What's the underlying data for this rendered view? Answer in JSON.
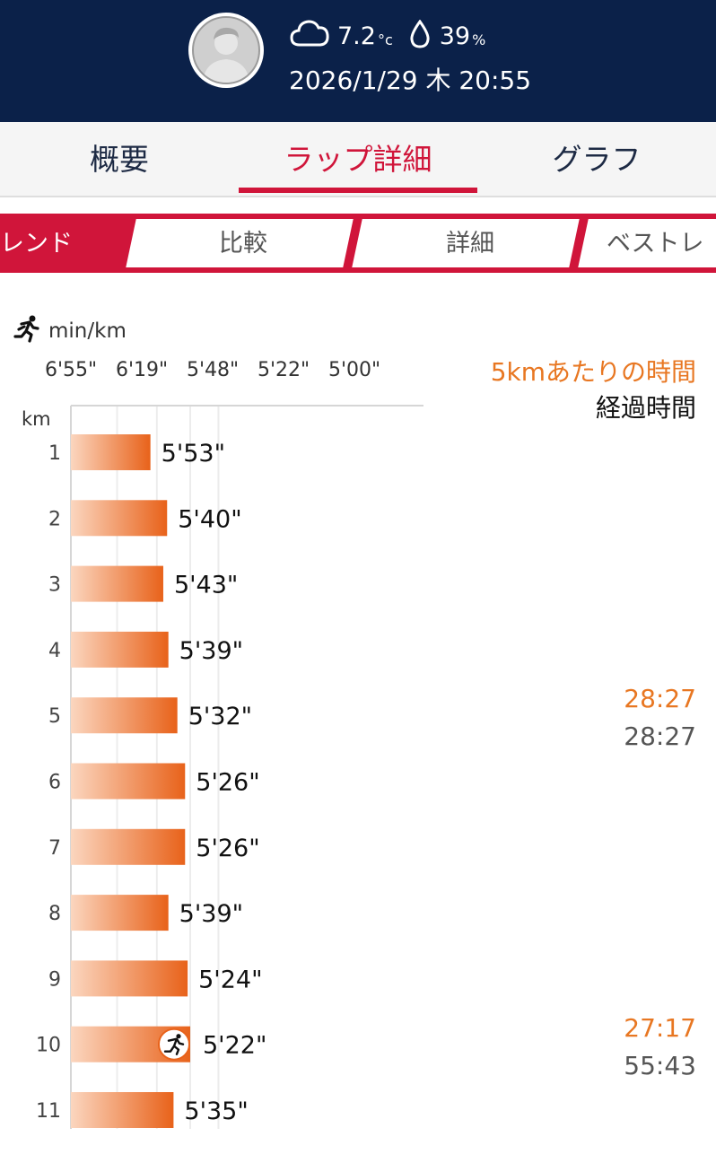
{
  "header": {
    "temperature": "7.2",
    "temperature_unit": "°c",
    "humidity": "39",
    "humidity_unit": "%",
    "datetime": "2026/1/29 木 20:55",
    "weather_icon": "cloud-icon",
    "humidity_icon": "water-drop-icon",
    "avatar_icon": "user-avatar-icon"
  },
  "tabs": [
    {
      "label": "概要"
    },
    {
      "label": "ラップ詳細"
    },
    {
      "label": "グラフ"
    }
  ],
  "subtabs": [
    {
      "label": "レンド"
    },
    {
      "label": "比較"
    },
    {
      "label": "詳細"
    },
    {
      "label": "ベストレ"
    }
  ],
  "chart_unit": "min/km",
  "legend": {
    "split_label": "5kmあたりの時間",
    "elapsed_label": "経過時間"
  },
  "colors": {
    "header_bg": "#0b2149",
    "accent_red": "#d0153a",
    "bar_orange": "#e8621a",
    "split_orange": "#e87722"
  },
  "chart_data": {
    "type": "bar",
    "orientation": "horizontal",
    "xlabel": "min/km",
    "ylabel": "km",
    "x_ticks": [
      "6'55\"",
      "6'19\"",
      "5'48\"",
      "5'22\"",
      "5'00\""
    ],
    "categories": [
      "1",
      "2",
      "3",
      "4",
      "5",
      "6",
      "7",
      "8",
      "9",
      "10",
      "11"
    ],
    "values": [
      "5'53\"",
      "5'40\"",
      "5'43\"",
      "5'39\"",
      "5'32\"",
      "5'26\"",
      "5'26\"",
      "5'39\"",
      "5'24\"",
      "5'22\"",
      "5'35\""
    ],
    "values_seconds": [
      353,
      340,
      343,
      339,
      332,
      326,
      326,
      339,
      324,
      322,
      335
    ],
    "best_lap_index": 9,
    "best_lap_icon": "runner-icon",
    "grid": true,
    "segment_summaries": [
      {
        "after_km": "5",
        "split": "28:27",
        "elapsed": "28:27"
      },
      {
        "after_km": "10",
        "split": "27:17",
        "elapsed": "55:43"
      }
    ]
  }
}
